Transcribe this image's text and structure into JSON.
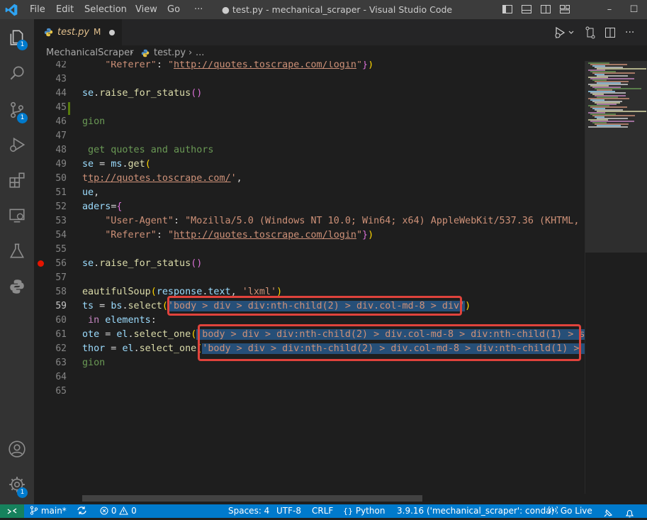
{
  "window": {
    "title": "● test.py - mechanical_scraper - Visual Studio Code",
    "menu": [
      "File",
      "Edit",
      "Selection",
      "View",
      "Go",
      "···"
    ],
    "controls": {
      "minimize": "–",
      "maximize": "☐",
      "close": "✕"
    }
  },
  "activity": {
    "badges": {
      "explorer": "1",
      "source_control": "1",
      "manage": "1"
    }
  },
  "tab": {
    "name": "test.py",
    "modified": "M"
  },
  "breadcrumbs": {
    "folder": "MechanicalScraper",
    "sep": "›",
    "file": "test.py",
    "sep2": "›",
    "more": "..."
  },
  "editor": {
    "line_numbers": [
      "42",
      "43",
      "44",
      "45",
      "46",
      "47",
      "48",
      "49",
      "50",
      "51",
      "52",
      "53",
      "54",
      "55",
      "56",
      "57",
      "58",
      "59",
      "60",
      "61",
      "62",
      "63",
      "64",
      "65"
    ],
    "active_line": "59",
    "breakpoint_line": "56"
  },
  "statusbar": {
    "branch": "main*",
    "errors": "0",
    "warnings": "0",
    "spaces": "Spaces: 4",
    "encoding": "UTF-8",
    "eol": "CRLF",
    "language": "Python",
    "interpreter": "3.9.16 ('mechanical_scraper': conda)",
    "golive": "Go Live"
  },
  "colors": {
    "statusbar": "#007acc",
    "remote": "#16825d",
    "highlight_box": "#e0433c",
    "selection": "#264f78"
  }
}
